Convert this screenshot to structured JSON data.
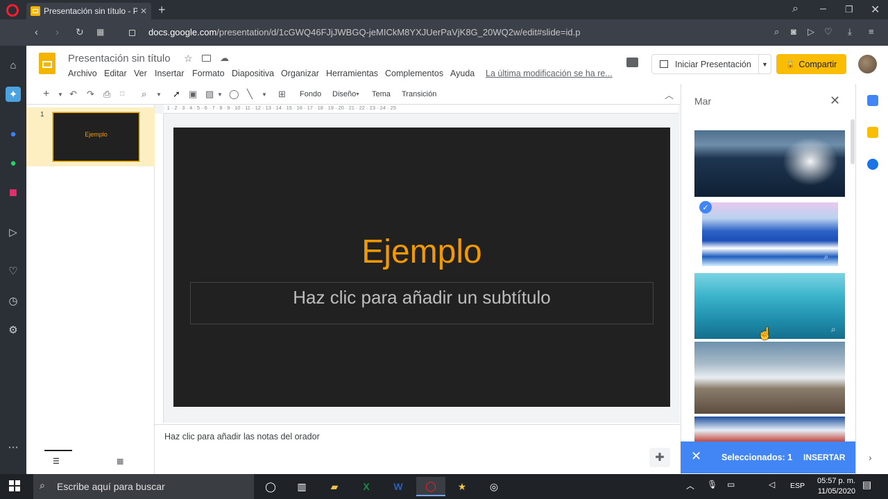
{
  "browser": {
    "tab_title": "Presentación sin título - Pr",
    "url_domain": "docs.google.com",
    "url_path": "/presentation/d/1cGWQ46FJjJWBGQ-jeMICkM8YXJUerPaVjK8G_20WQ2w/edit#slide=id.p",
    "new_tab": "+"
  },
  "doc": {
    "title": "Presentación sin título",
    "menus": [
      "Archivo",
      "Editar",
      "Ver",
      "Insertar",
      "Formato",
      "Diapositiva",
      "Organizar",
      "Herramientas",
      "Complementos",
      "Ayuda"
    ],
    "last_modified": "La última modificación se ha re...",
    "present_label": "Iniciar Presentación",
    "share_label": "Compartir"
  },
  "toolbar": {
    "background": "Fondo",
    "design": "Diseño",
    "theme": "Tema",
    "transition": "Transición"
  },
  "ruler": "· 1 · 2 · 3 · 4 · 5 · 6 · 7 · 8 · 9 · 10 · 11 · 12 · 13 · 14 · 15 · 16 · 17 · 18 · 19 · 20 · 21 · 22 · 23 · 24 · 25",
  "filmstrip": {
    "slide_number": "1",
    "thumb_text": "Ejemplo"
  },
  "slide": {
    "title": "Ejemplo",
    "subtitle_placeholder": "Haz clic para añadir un subtítulo"
  },
  "notes": {
    "placeholder": "Haz clic para añadir las notas del orador"
  },
  "image_panel": {
    "query": "Mar",
    "selected_label": "Seleccionados: 1",
    "insert_label": "INSERTAR"
  },
  "taskbar": {
    "search_placeholder": "Escribe aquí para buscar",
    "language": "ESP",
    "time": "05:57 p. m.",
    "date": "11/05/2020"
  },
  "colors": {
    "accent_yellow": "#fbbc04",
    "slide_title": "#f29900",
    "panel_blue": "#4285f4"
  }
}
